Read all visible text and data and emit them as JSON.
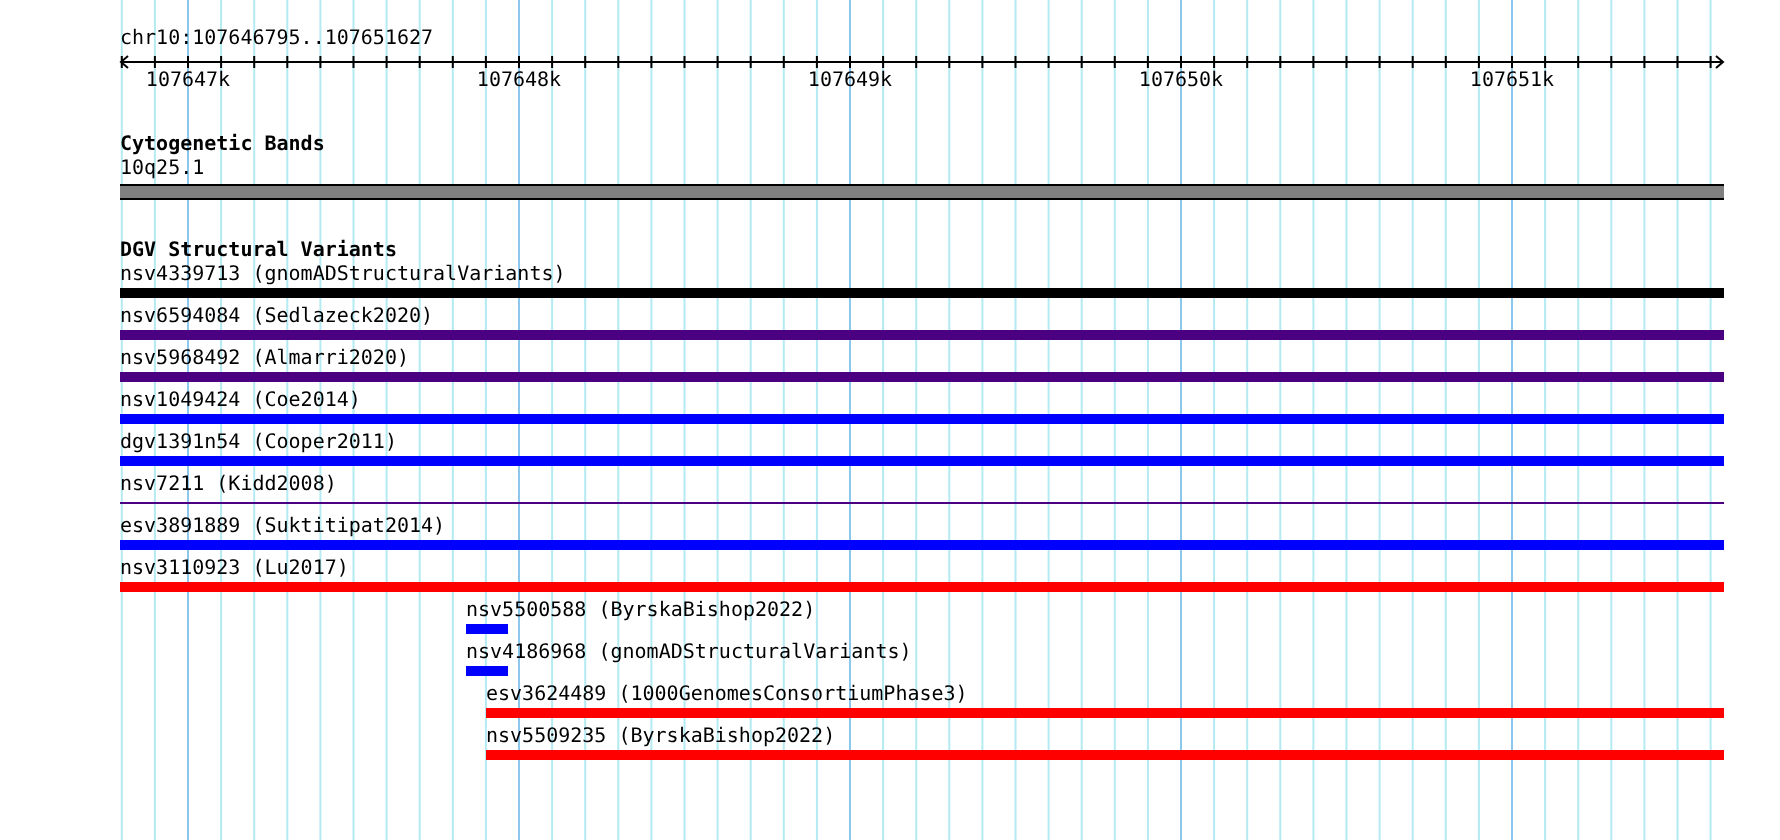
{
  "ruler": {
    "region": "chr10:107646795..107651627",
    "ticks": [
      "107647k",
      "107648k",
      "107649k",
      "107650k",
      "107651k"
    ]
  },
  "cytoband": {
    "title": "Cytogenetic Bands",
    "label": "10q25.1"
  },
  "variants": {
    "title": "DGV Structural Variants",
    "features": [
      {
        "label": "nsv4339713 (gnomADStructuralVariants)",
        "color": "#000000",
        "kind": "full"
      },
      {
        "label": "nsv6594084 (Sedlazeck2020)",
        "color": "#4b0082",
        "kind": "full"
      },
      {
        "label": "nsv5968492 (Almarri2020)",
        "color": "#4b0082",
        "kind": "full"
      },
      {
        "label": "nsv1049424 (Coe2014)",
        "color": "#0000ff",
        "kind": "full"
      },
      {
        "label": "dgv1391n54 (Cooper2011)",
        "color": "#0000ff",
        "kind": "full"
      },
      {
        "label": "nsv7211 (Kidd2008)",
        "color": "#4b0082",
        "kind": "line"
      },
      {
        "label": "esv3891889 (Suktitipat2014)",
        "color": "#0000ff",
        "kind": "full"
      },
      {
        "label": "nsv3110923 (Lu2017)",
        "color": "#ff0000",
        "kind": "full"
      },
      {
        "label": "nsv5500588 (ByrskaBishop2022)",
        "color": "#0000ff",
        "kind": "short"
      },
      {
        "label": "nsv4186968 (gnomADStructuralVariants)",
        "color": "#0000ff",
        "kind": "short"
      },
      {
        "label": "esv3624489 (1000GenomesConsortiumPhase3)",
        "color": "#ff0000",
        "kind": "right"
      },
      {
        "label": "nsv5509235 (ByrskaBishop2022)",
        "color": "#ff0000",
        "kind": "right"
      }
    ]
  }
}
